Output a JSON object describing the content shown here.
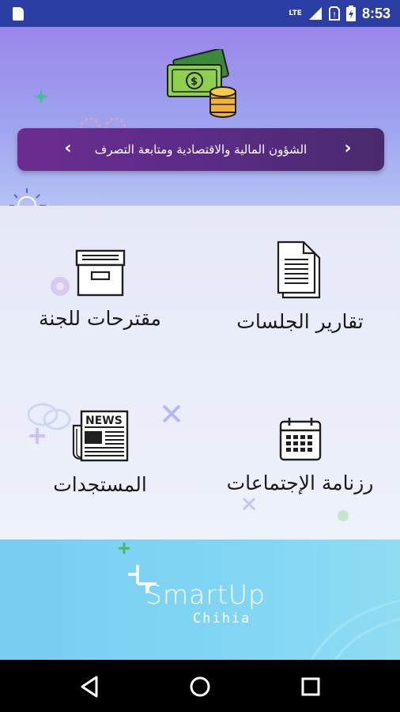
{
  "status_bar": {
    "network": "LTE",
    "time": "8:53"
  },
  "banner": {
    "title": "الشؤون المالية والاقتصادية ومتابعة التصرف",
    "prev_arrow": "‹",
    "next_arrow": "›"
  },
  "tiles": [
    {
      "label": "تقارير الجلسات",
      "icon": "document-icon"
    },
    {
      "label": "مقترحات للجنة",
      "icon": "archive-box-icon"
    },
    {
      "label": "رزنامة الإجتماعات",
      "icon": "calendar-icon"
    },
    {
      "label": "المستجدات",
      "icon": "newspaper-icon"
    }
  ],
  "newspaper_text": "NEWS",
  "footer": {
    "logo_main": "SmartUp",
    "logo_sub": "Chihia"
  },
  "colors": {
    "status_bar": "#2a3ea4",
    "banner": "#5b2c87",
    "footer": "#82d6f4"
  }
}
